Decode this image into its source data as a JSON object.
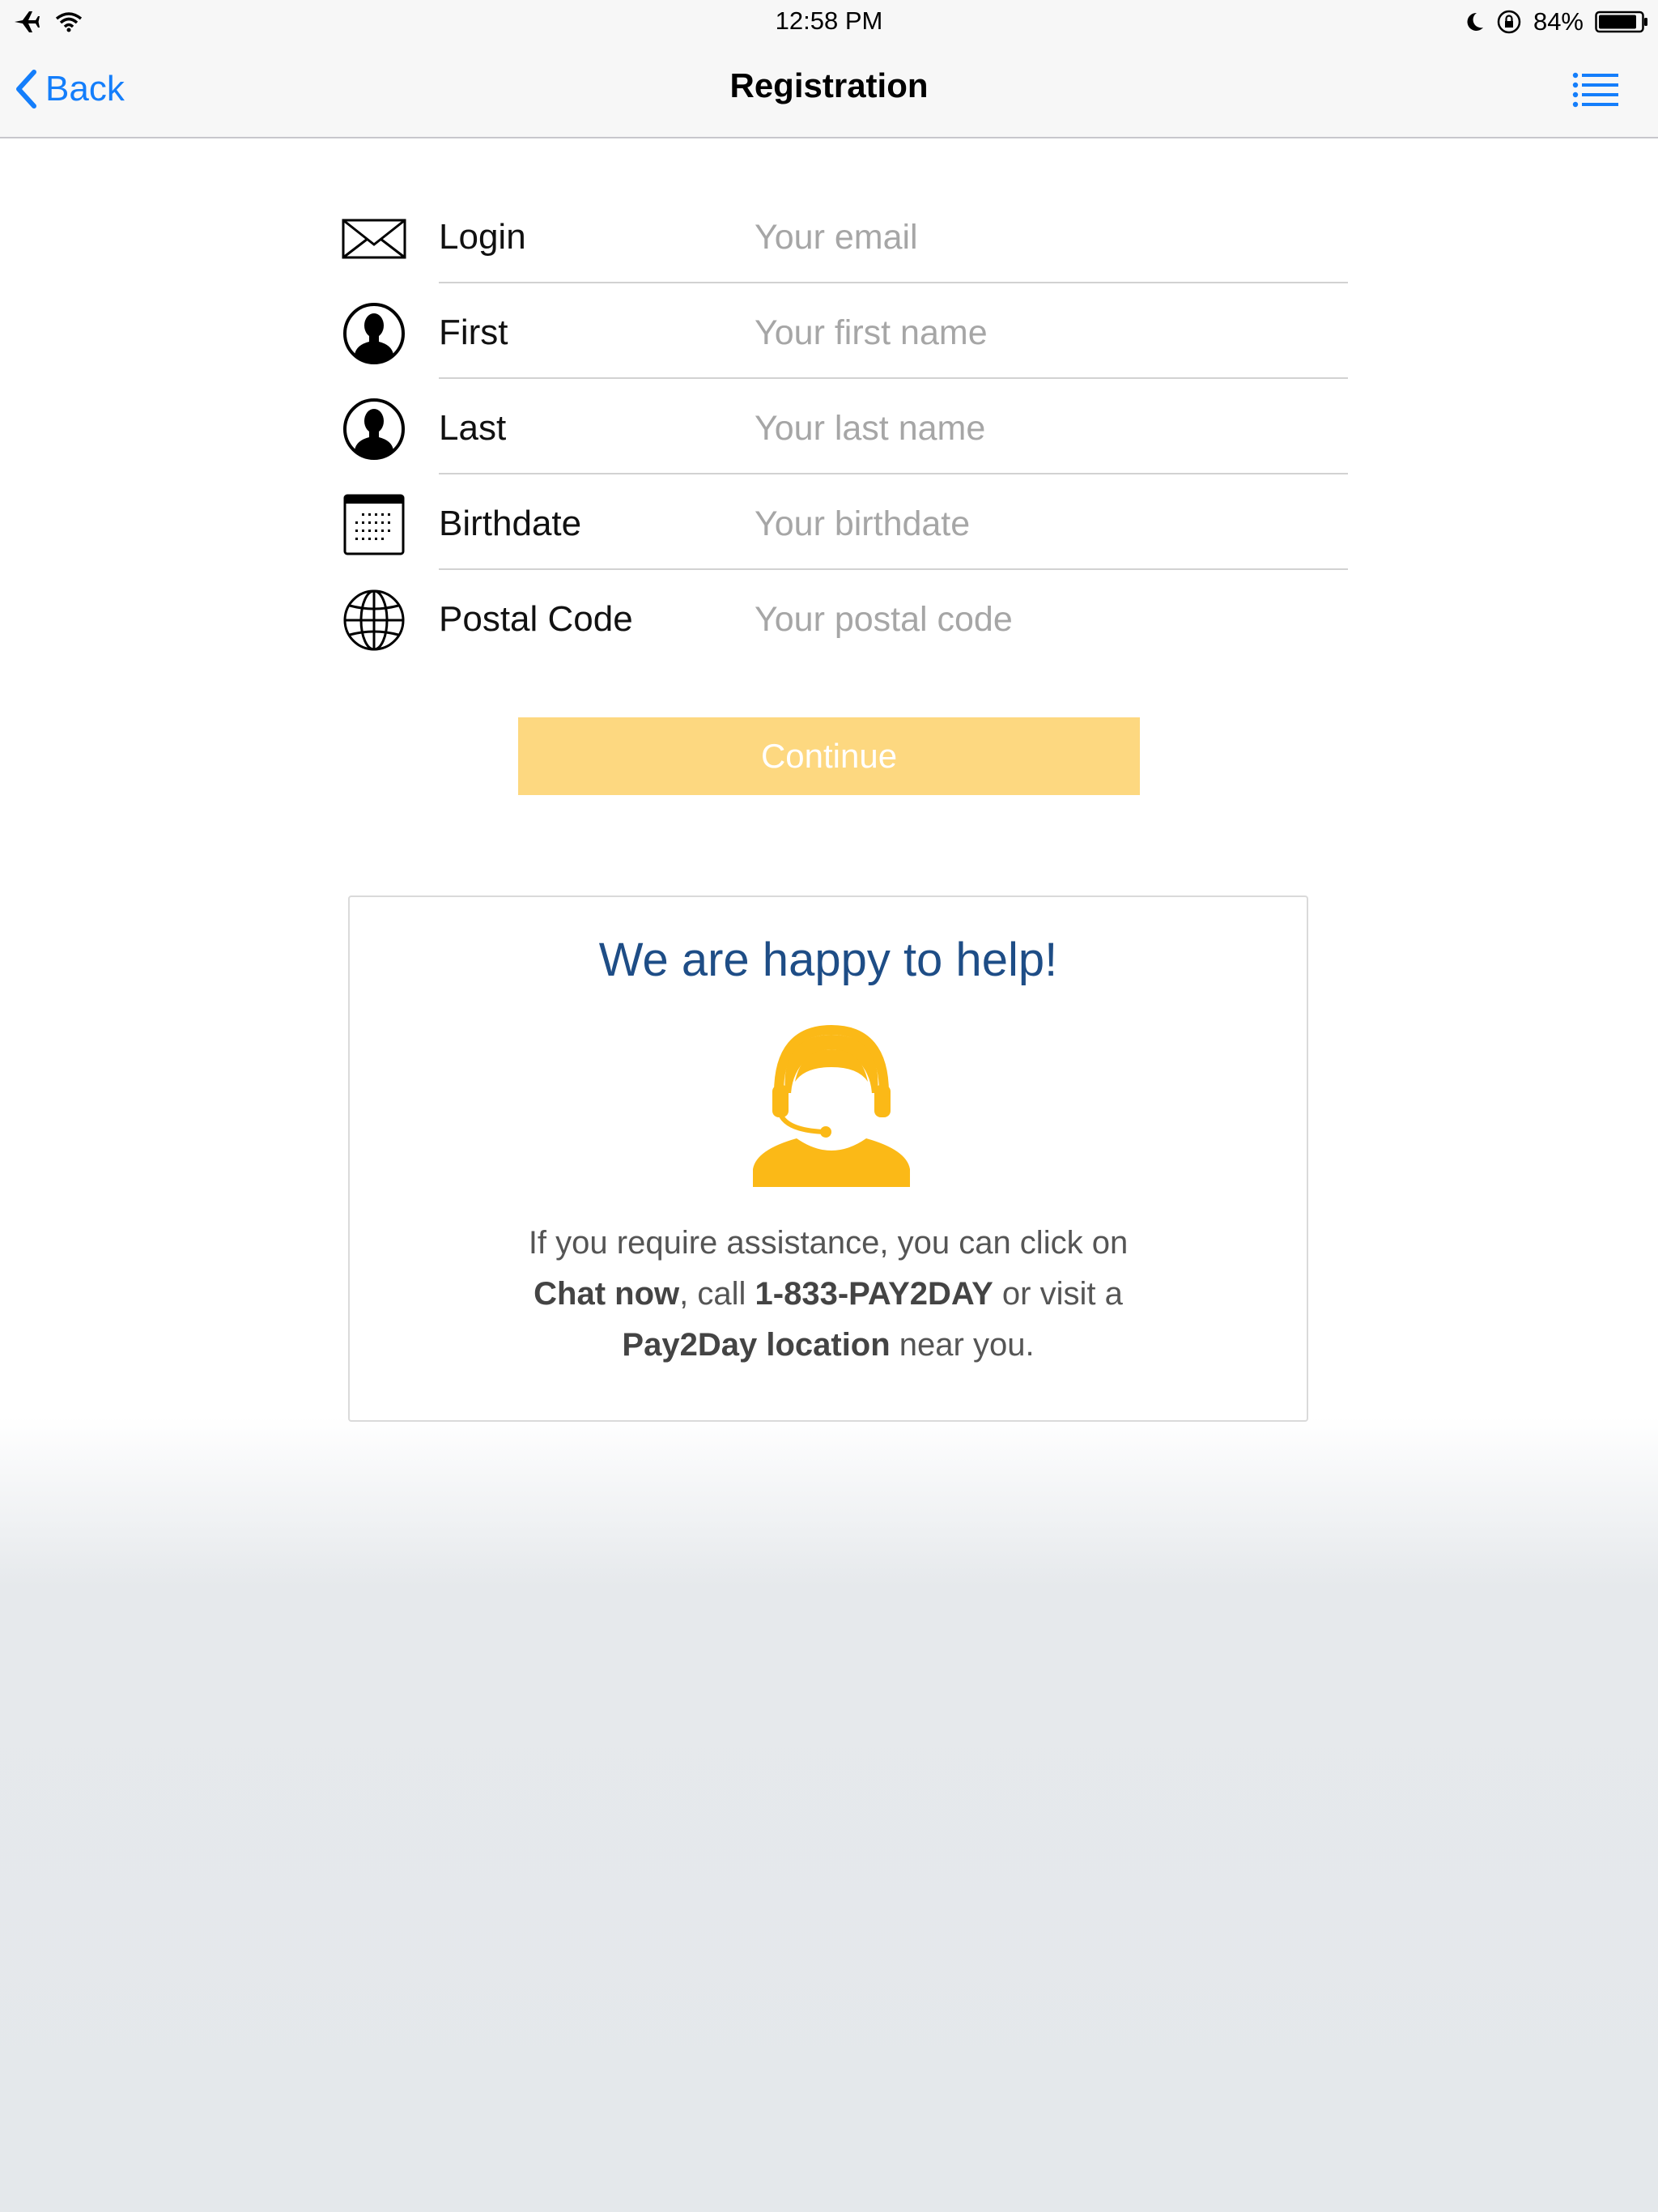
{
  "status_bar": {
    "time": "12:58 PM",
    "battery": "84%"
  },
  "nav": {
    "back_label": "Back",
    "title": "Registration"
  },
  "form": {
    "fields": [
      {
        "label": "Login",
        "placeholder": "Your email",
        "icon": "envelope-icon"
      },
      {
        "label": "First",
        "placeholder": "Your first name",
        "icon": "person-icon"
      },
      {
        "label": "Last",
        "placeholder": "Your last name",
        "icon": "person-icon"
      },
      {
        "label": "Birthdate",
        "placeholder": "Your birthdate",
        "icon": "calendar-icon"
      },
      {
        "label": "Postal Code",
        "placeholder": "Your postal code",
        "icon": "globe-icon"
      }
    ],
    "continue_label": "Continue"
  },
  "help": {
    "title": "We are happy to help!",
    "line1": "If you require assistance, you can click on",
    "chat_link": "Chat now",
    "call_text": ", call ",
    "phone": "1-833-PAY2DAY",
    "visit_text": " or visit a",
    "location_link": "Pay2Day location",
    "near_text": " near you."
  },
  "colors": {
    "accent": "#147efb",
    "button": "#fdd880",
    "help_title": "#1e4d86",
    "agent": "#fbb917"
  }
}
